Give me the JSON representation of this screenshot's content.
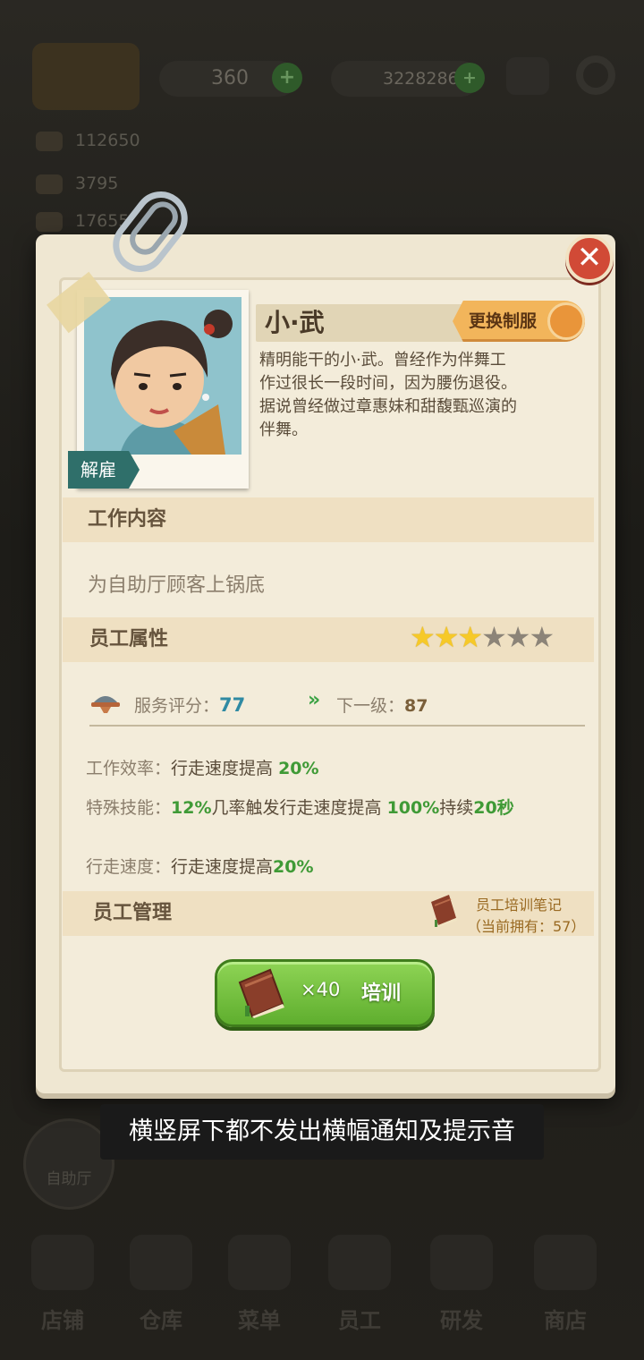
{
  "hud": {
    "currency1": "360",
    "currency2": "3228286",
    "plus_symbol": "+",
    "stat1": "112650",
    "stat2": "3795",
    "stat3": "17655"
  },
  "employee": {
    "name": "小·武",
    "change_uniform_label": "更换制服",
    "dismiss_label": "解雇",
    "close_symbol": "✕",
    "description": "精明能干的小·武。曾经作为伴舞工作过很长一段时间，因为腰伤退役。据说曾经做过章惠妹和甜馥甄巡演的伴舞。"
  },
  "work": {
    "title": "工作内容",
    "content": "为自助厅顾客上锅底"
  },
  "attributes": {
    "title": "员工属性",
    "stars_filled": 3,
    "stars_total": 6,
    "service_label": "服务评分：",
    "service_score": "77",
    "next_label": "下一级：",
    "next_score": "87",
    "chevron": "»",
    "efficiency_label": "工作效率：",
    "efficiency_text": "行走速度提高",
    "efficiency_value": "20%",
    "skill_label": "特殊技能：",
    "skill_pct": "12%",
    "skill_mid": "几率触发行走速度提高",
    "skill_value": "100%",
    "skill_tail": "持续",
    "skill_duration": "20秒",
    "speed_label": "行走速度：",
    "speed_text": "行走速度提高",
    "speed_value": "20%"
  },
  "management": {
    "title": "员工管理",
    "note_title": "员工培训笔记",
    "note_owned": "（当前拥有：57）"
  },
  "train_button": {
    "count": "×40",
    "label": "培训"
  },
  "toast": "横竖屏下都不发出横幅通知及提示音",
  "background": {
    "buffet_label": "自助厅",
    "nav": [
      "店铺",
      "仓库",
      "菜单",
      "员工",
      "研发",
      "商店"
    ]
  },
  "colors": {
    "panel": "#efe7d2",
    "section_bar": "#efe0c2",
    "green_value": "#3f9a36",
    "score_blue": "#2f8aa3",
    "star_on": "#f6c928",
    "star_off": "#8c8478",
    "close_red": "#d14a36",
    "uniform_orange": "#f2b55b",
    "train_green": "#5fae2e"
  }
}
